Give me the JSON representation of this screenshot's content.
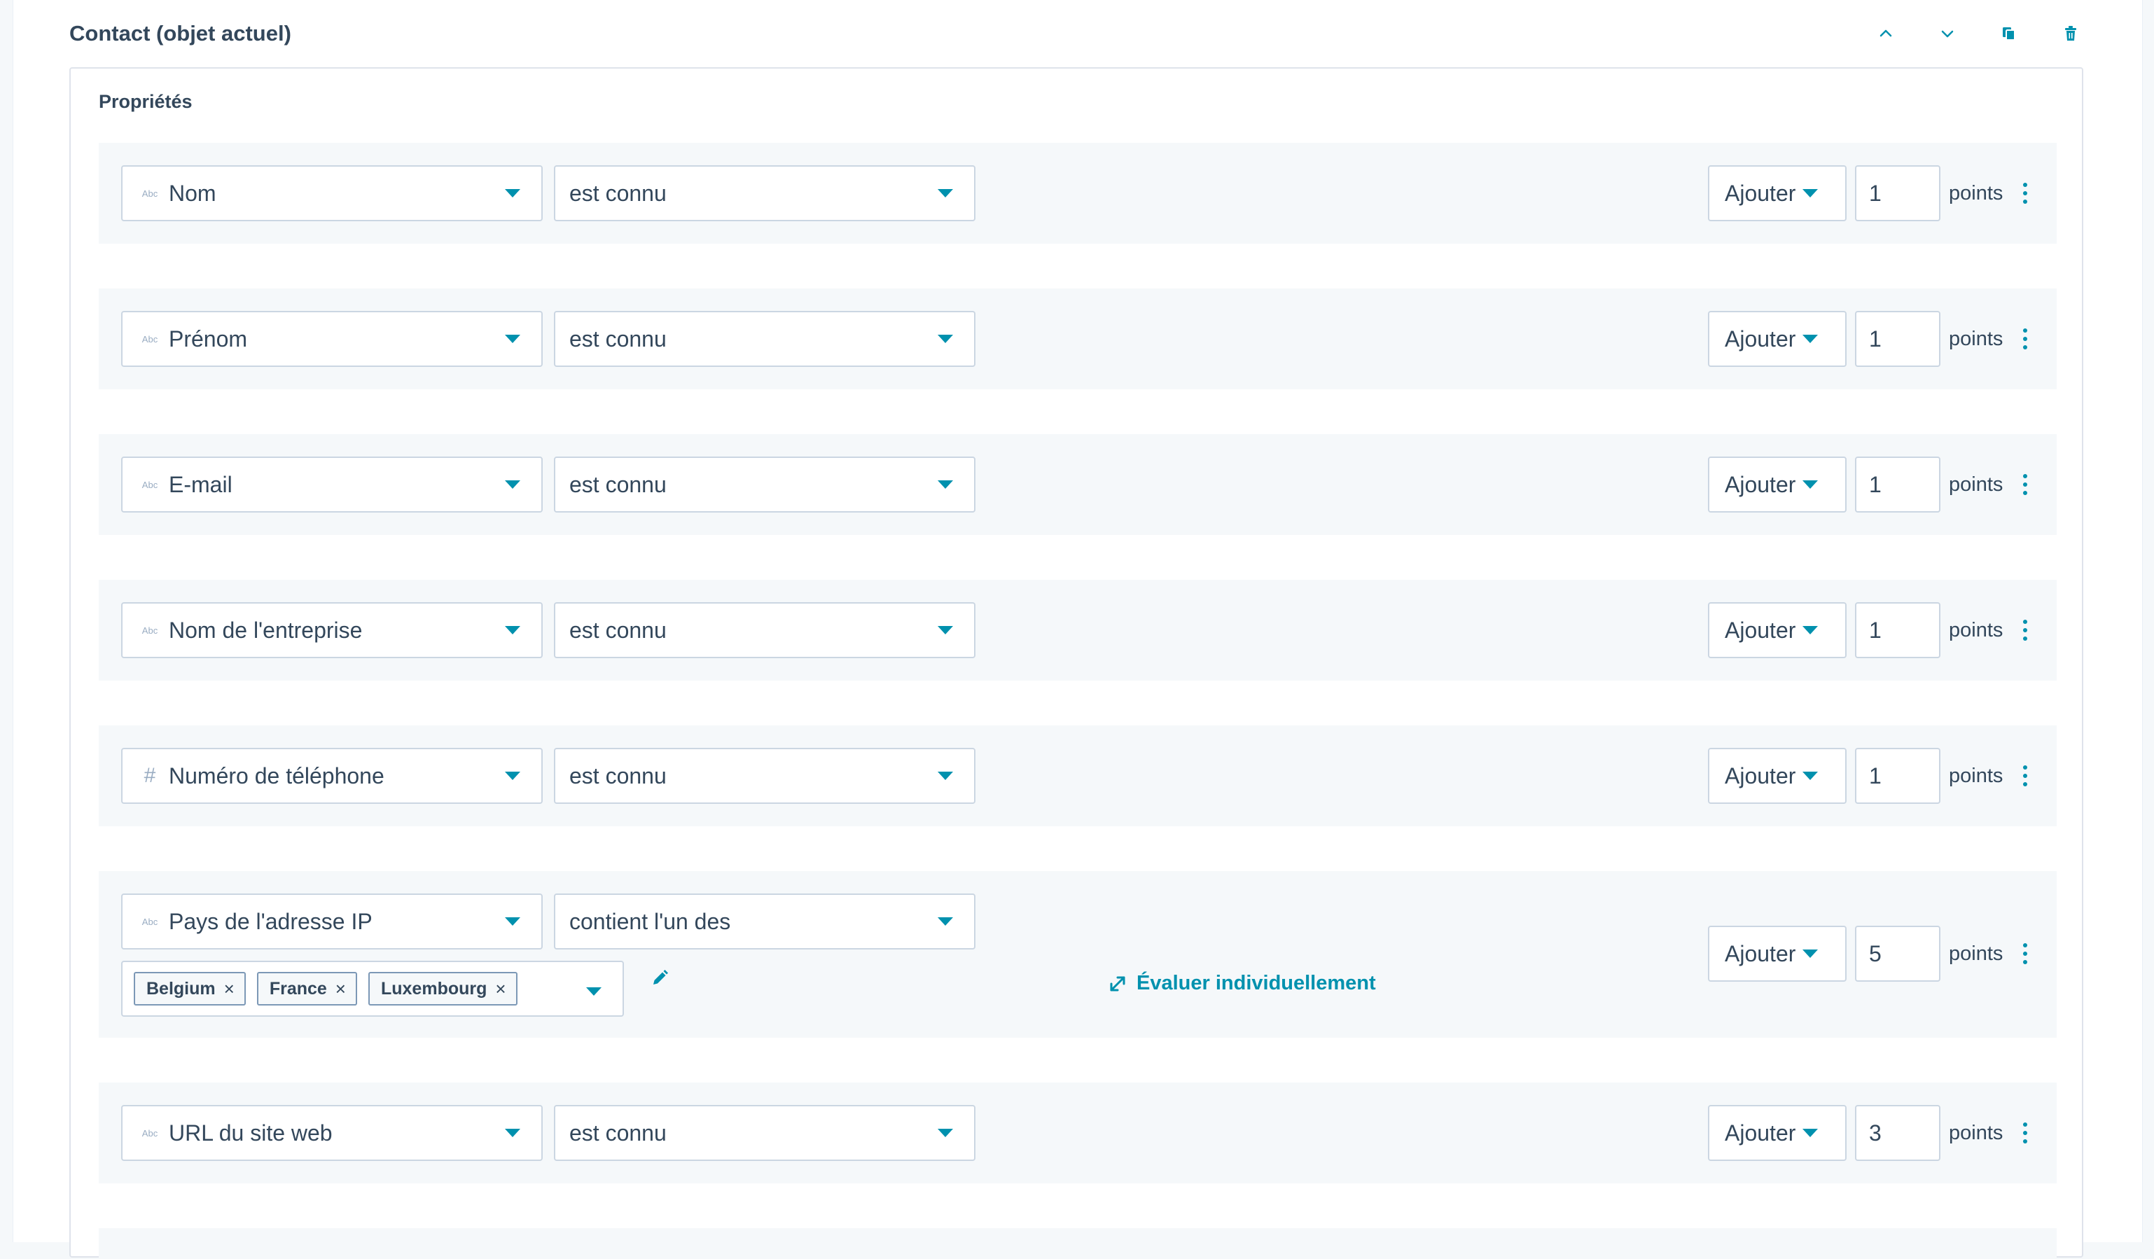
{
  "card": {
    "title": "Contact (objet actuel)"
  },
  "properties_section": {
    "title": "Propriétés"
  },
  "rules": [
    {
      "property_type": "Abc",
      "property": "Nom",
      "operator": "est connu",
      "action": "Ajouter",
      "points": "1",
      "points_label": "points"
    },
    {
      "property_type": "Abc",
      "property": "Prénom",
      "operator": "est connu",
      "action": "Ajouter",
      "points": "1",
      "points_label": "points"
    },
    {
      "property_type": "Abc",
      "property": "E-mail",
      "operator": "est connu",
      "action": "Ajouter",
      "points": "1",
      "points_label": "points"
    },
    {
      "property_type": "Abc",
      "property": "Nom de l'entreprise",
      "operator": "est connu",
      "action": "Ajouter",
      "points": "1",
      "points_label": "points"
    },
    {
      "property_type": "#",
      "property": "Numéro de téléphone",
      "operator": "est connu",
      "action": "Ajouter",
      "points": "1",
      "points_label": "points"
    },
    {
      "property_type": "Abc",
      "property": "Pays de l'adresse IP",
      "operator": "contient l'un des",
      "action": "Ajouter",
      "points": "5",
      "points_label": "points",
      "values": [
        "Belgium",
        "France",
        "Luxembourg"
      ],
      "evaluate_link": "Évaluer individuellement"
    },
    {
      "property_type": "Abc",
      "property": "URL du site web",
      "operator": "est connu",
      "action": "Ajouter",
      "points": "3",
      "points_label": "points"
    }
  ],
  "colors": {
    "accent": "#0091ae",
    "text": "#33475b",
    "row_bg": "#f5f8fa",
    "border": "#cbd6e2"
  },
  "icons": {
    "move_up": "chevron-up-icon",
    "move_down": "chevron-down-icon",
    "duplicate": "copy-icon",
    "delete": "trash-icon",
    "edit": "pencil-icon",
    "expand": "expand-arrows-icon",
    "more": "kebab-menu-icon"
  }
}
